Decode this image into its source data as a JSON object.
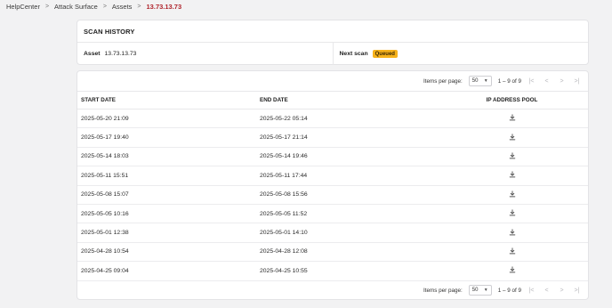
{
  "breadcrumb": {
    "items": [
      "HelpCenter",
      "Attack Surface",
      "Assets"
    ],
    "current": "13.73.13.73"
  },
  "scan_history": {
    "title": "SCAN HISTORY",
    "asset_label": "Asset",
    "asset_value": "13.73.13.73",
    "next_scan_label": "Next scan",
    "next_scan_status": "Queued"
  },
  "pagination": {
    "items_per_page_label": "Items per page:",
    "items_per_page_value": "50",
    "range_text": "1 – 9 of 9"
  },
  "table": {
    "headers": {
      "start": "START DATE",
      "end": "END DATE",
      "pool": "IP ADDRESS POOL"
    },
    "rows": [
      {
        "start": "2025-05-20 21:09",
        "end": "2025-05-22 05:14"
      },
      {
        "start": "2025-05-17 19:40",
        "end": "2025-05-17 21:14"
      },
      {
        "start": "2025-05-14 18:03",
        "end": "2025-05-14 19:46"
      },
      {
        "start": "2025-05-11 15:51",
        "end": "2025-05-11 17:44"
      },
      {
        "start": "2025-05-08 15:07",
        "end": "2025-05-08 15:56"
      },
      {
        "start": "2025-05-05 10:16",
        "end": "2025-05-05 11:52"
      },
      {
        "start": "2025-05-01 12:38",
        "end": "2025-05-01 14:10"
      },
      {
        "start": "2025-04-28 10:54",
        "end": "2025-04-28 12:08"
      },
      {
        "start": "2025-04-25 09:04",
        "end": "2025-04-25 10:55"
      }
    ]
  },
  "icons": {
    "download": "download-icon",
    "chevron": "chevron-right-icon"
  },
  "colors": {
    "accent": "#b0262e",
    "badge": "#f6b21b"
  }
}
